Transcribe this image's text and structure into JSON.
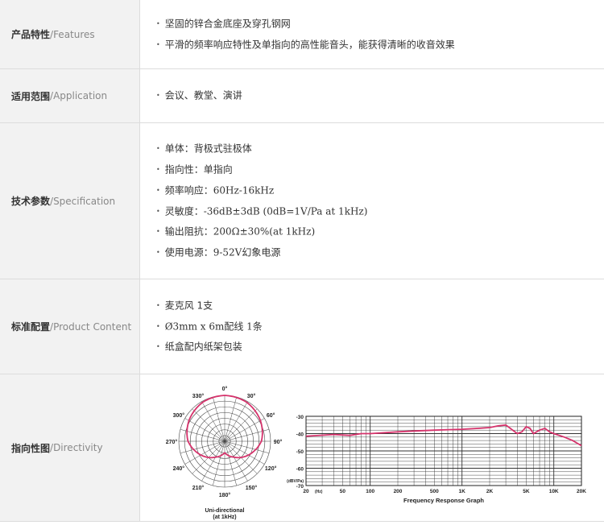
{
  "rows": [
    {
      "cn": "产品特性",
      "en": "Features",
      "items": [
        "坚固的锌合金底座及穿孔钢网",
        "平滑的频率响应特性及单指向的高性能音头，能获得清晰的收音效果"
      ]
    },
    {
      "cn": "适用范围",
      "en": "Application",
      "items": [
        "会议、教堂、演讲"
      ]
    },
    {
      "cn": "技术参数",
      "en": "Specification",
      "items": [
        "单体：背极式驻极体",
        "指向性：单指向",
        "频率响应：60Hz-16kHz",
        "灵敏度：-36dB±3dB (0dB=1V/Pa at 1kHz)",
        "输出阻抗：200Ω±30%(at 1kHz)",
        "使用电源：9-52V幻象电源"
      ]
    },
    {
      "cn": "标准配置",
      "en": "Product Content",
      "items": [
        "麦克风 1支",
        "Ø3mm x 6m配线 1条",
        "纸盒配内纸架包装"
      ]
    },
    {
      "cn": "指向性图",
      "en": "Directivity",
      "items": []
    }
  ],
  "slash": "/",
  "chart_data": [
    {
      "type": "polar",
      "angle_labels": [
        "0°",
        "30°",
        "60°",
        "90°",
        "120°",
        "150°",
        "180°",
        "210°",
        "240°",
        "270°",
        "300°",
        "330°"
      ],
      "caption_1": "Uni-directional",
      "caption_2": "(at 1kHz)",
      "series": [
        {
          "values": [
            0,
            -0.5,
            -2,
            -4,
            -8,
            -12,
            -15,
            -12,
            -8,
            -4,
            -2,
            -0.5
          ]
        }
      ]
    },
    {
      "type": "line",
      "title": "Frequency Response Graph",
      "ylabel": "(dBV/Pa)",
      "ytick_labels": [
        "-30",
        "-40",
        "-50",
        "-60",
        "-70"
      ],
      "ylim": [
        -70,
        -30
      ],
      "xtick_labels": [
        "20",
        "50",
        "100",
        "200",
        "500",
        "1K",
        "2K",
        "5K",
        "10K",
        "20K"
      ],
      "xunit": "(Hz)",
      "x": [
        20,
        40,
        60,
        80,
        100,
        200,
        300,
        500,
        1000,
        1500,
        2000,
        2500,
        3000,
        4000,
        4500,
        5000,
        5500,
        6000,
        7000,
        8000,
        9000,
        10000,
        13000,
        16000,
        20000
      ],
      "series": [
        {
          "values": [
            -41.5,
            -40.5,
            -41,
            -40,
            -40,
            -39,
            -38.5,
            -38,
            -37.5,
            -37,
            -36.5,
            -35.5,
            -35,
            -40,
            -39,
            -36,
            -37,
            -40,
            -38,
            -37,
            -39,
            -40,
            -42,
            -44,
            -47
          ]
        }
      ]
    }
  ]
}
